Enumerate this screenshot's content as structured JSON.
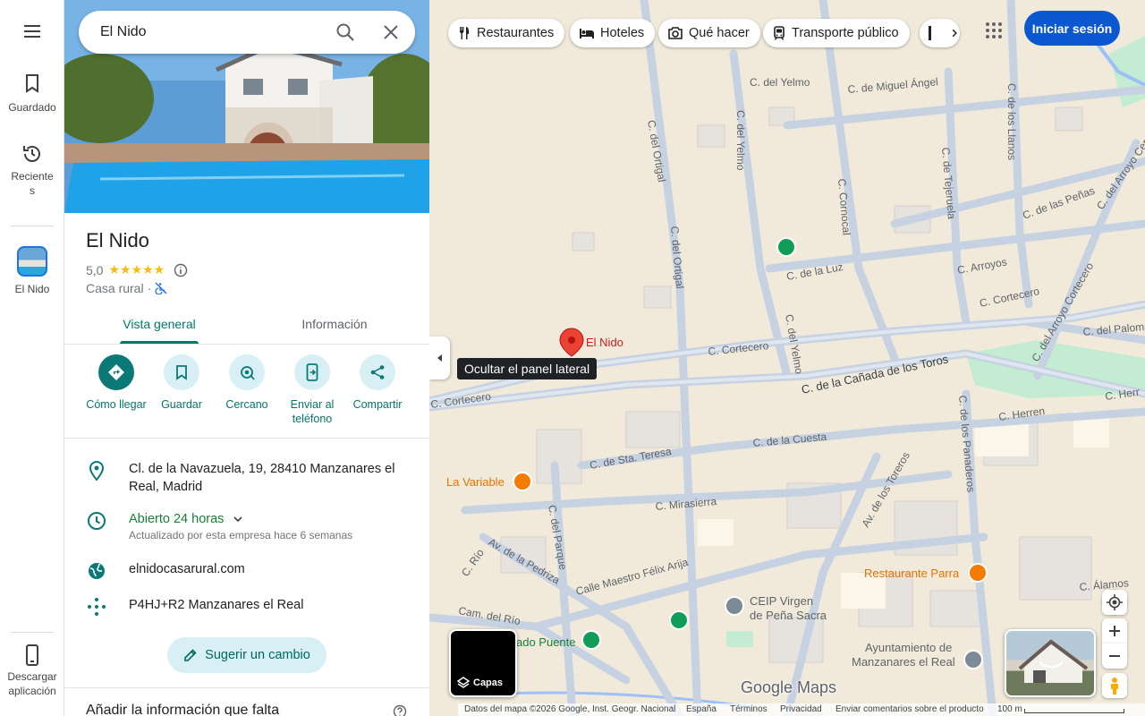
{
  "search": {
    "value": "El Nido"
  },
  "rail": {
    "saved": "Guardado",
    "recent_1": "Reciente",
    "recent_2": "s",
    "place": "El Nido",
    "download_1": "Descargar",
    "download_2": "aplicación"
  },
  "place": {
    "name": "El Nido",
    "rating": "5,0",
    "stars": "★★★★★",
    "category": "Casa rural",
    "tabs": [
      "Vista general",
      "Información"
    ],
    "actions": [
      "Cómo llegar",
      "Guardar",
      "Cercano",
      "Enviar al",
      "teléfono",
      "Compartir"
    ],
    "address_1": "Cl. de la Navazuela, 19, 28410 Manzanares el",
    "address_2": "Real, Madrid",
    "hours": "Abierto 24 horas",
    "hours_note": "Actualizado por esta empresa hace 6 semanas",
    "website": "elnidocasarural.com",
    "plus_code": "P4HJ+R2 Manzanares el Real",
    "suggest": "Sugerir un cambio",
    "add_info": "Añadir la información que falta"
  },
  "chips": [
    "Restaurantes",
    "Hoteles",
    "Qué hacer",
    "Transporte público"
  ],
  "signin": "Iniciar sesión",
  "tooltip": "Ocultar el panel lateral",
  "layers": "Capas",
  "brand": "Google Maps",
  "map_labels": {
    "marker": "El Nido",
    "la_variable": "La Variable",
    "restaurante_parra": "Restaurante Parra",
    "ceip_1": "CEIP Virgen",
    "ceip_2": "de Peña Sacra",
    "ayto_1": "Ayuntamiento de",
    "ayto_2": "Manzanares el Real",
    "puente": "ado Puente",
    "streets": {
      "yelmo": "C. del Yelmo",
      "miguel_angel": "C. de Miguel Ángel",
      "llanos": "C. de los Llanos",
      "ortigal1": "C. del Ortigal",
      "yelmo2": "C. del Yelmo",
      "cornocal": "C. Cornocal",
      "tejeruela": "C. de Tejeruela",
      "penas": "C. de las Peñas",
      "arroyo": "C. del Arroyo Cercero",
      "ortigal2": "C. del Ortigal",
      "luz": "C. de la Luz",
      "arroyos": "C. Arroyos",
      "cortecero1": "C. Cortecero",
      "arroyo_cortecero": "C. del Arroyo Cortecero",
      "palomar": "C. del Palomar",
      "cortecero2": "C. Cortecero",
      "yelmo3": "C. del Yelmo",
      "canada": "C. de la Cañada de los Toros",
      "herr": "C. Herr",
      "cortecero3": "C. Cortecero",
      "herren": "C. Herren",
      "santa_teresa": "C. de Sta. Teresa",
      "cuesta": "C. de la Cuesta",
      "panaderos": "C. de los Panaderos",
      "toreros": "Av. de los Toreros",
      "mirasierra": "C. Mirasierra",
      "parque": "C. del Parque",
      "rio": "C. Río",
      "pedriza": "Av. de la Pedriza",
      "maestro": "Calle Maestro Félix Arija",
      "camino": "Cam. del Río",
      "alamos": "C. Álamos"
    }
  },
  "footer": {
    "data": "Datos del mapa ©2026 Google, Inst. Geogr. Nacional",
    "country": "España",
    "terms": "Términos",
    "privacy": "Privacidad",
    "feedback": "Enviar comentarios sobre el producto",
    "scale": "100 m"
  }
}
